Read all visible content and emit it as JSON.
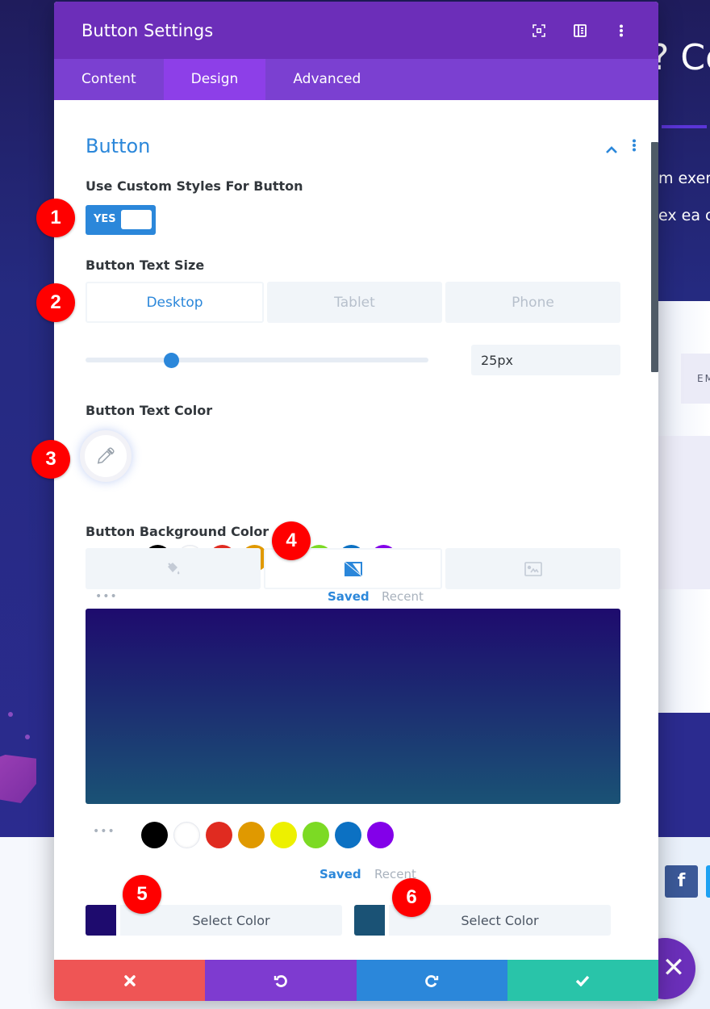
{
  "background_page": {
    "heading_fragment": "? Co",
    "text_line_1": "m exer",
    "text_line_2": "ex ea c",
    "email_label_fragment": "EM",
    "social_facebook": "f",
    "close_fab": "✕"
  },
  "modal": {
    "title": "Button Settings",
    "header_icons": [
      "fullscreen-icon",
      "sidebar-layout-icon",
      "more-vertical-icon"
    ],
    "tabs": [
      {
        "label": "Content",
        "active": false
      },
      {
        "label": "Design",
        "active": true
      },
      {
        "label": "Advanced",
        "active": false
      }
    ]
  },
  "section": {
    "title": "Button",
    "collapsed": false
  },
  "custom_styles": {
    "label": "Use Custom Styles For Button",
    "toggle_label": "YES",
    "enabled": true
  },
  "text_size": {
    "label": "Button Text Size",
    "devices": [
      {
        "label": "Desktop",
        "active": true
      },
      {
        "label": "Tablet",
        "active": false
      },
      {
        "label": "Phone",
        "active": false
      }
    ],
    "value": "25px",
    "slider_fraction": 0.25
  },
  "text_color": {
    "label": "Button Text Color",
    "swatches": [
      "#000000",
      "#ffffff",
      "#e02b20",
      "#e09900",
      "#edf000",
      "#7cda24",
      "#0c71c3",
      "#8300e9"
    ],
    "saved_label": "Saved",
    "recent_label": "Recent",
    "more_label": "•••"
  },
  "background_color": {
    "label": "Button Background Color",
    "type_tabs": [
      {
        "icon": "paint-bucket-icon",
        "active": false
      },
      {
        "icon": "gradient-icon",
        "active": true
      },
      {
        "icon": "image-icon",
        "active": false
      }
    ],
    "gradient_start": "#1e0b6e",
    "gradient_end": "#1a5275",
    "swatches": [
      "#000000",
      "#ffffff",
      "#e02b20",
      "#e09900",
      "#edf000",
      "#7cda24",
      "#0c71c3",
      "#8300e9"
    ],
    "saved_label": "Saved",
    "recent_label": "Recent",
    "more_label": "•••",
    "stop_1": {
      "color": "#1e0b6e",
      "button_label": "Select Color"
    },
    "stop_2": {
      "color": "#1a5275",
      "button_label": "Select Color"
    }
  },
  "footer": {
    "buttons": [
      {
        "name": "discard",
        "icon": "close-icon",
        "color": "#ef5555"
      },
      {
        "name": "undo",
        "icon": "undo-icon",
        "color": "#7e3bd0"
      },
      {
        "name": "redo",
        "icon": "redo-icon",
        "color": "#2b87da"
      },
      {
        "name": "save",
        "icon": "check-icon",
        "color": "#29c4a9"
      }
    ]
  },
  "annotations": [
    "1",
    "2",
    "3",
    "4",
    "5",
    "6"
  ],
  "colors": {
    "header_purple": "#6c2eb9",
    "tab_bar_purple": "#7b40d1",
    "active_tab_purple": "#8d3fe8",
    "accent_blue": "#2b87da",
    "annotation_red": "#ff0000"
  }
}
